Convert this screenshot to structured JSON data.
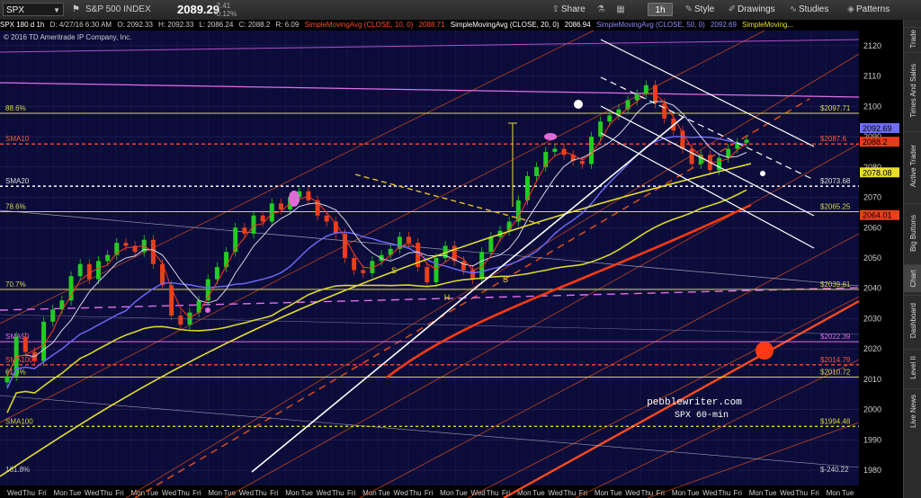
{
  "toolbar": {
    "symbol": "SPX",
    "index_name": "S&P 500 INDEX",
    "last_price": "2089.29",
    "change": "-2.41",
    "change_pct": "-0.12%",
    "share_label": "Share",
    "timeframe": "1h",
    "style_label": "Style",
    "drawings_label": "Drawings",
    "studies_label": "Studies",
    "patterns_label": "Patterns"
  },
  "infobar": {
    "title": "SPX 180 d 1h",
    "date": "D: 4/27/16 6:30 AM",
    "open": "O: 2092.33",
    "high": "H: 2092.33",
    "low": "L: 2086.24",
    "close": "C: 2088.2",
    "range": "R: 6.09",
    "sma10_label": "SimpleMovingAvg (CLOSE, 10, 0)",
    "sma10_value": "2088.71",
    "sma20_label": "SimpleMovingAvg (CLOSE, 20, 0)",
    "sma20_value": "2086.94",
    "sma50_label": "SimpleMovingAvg (CLOSE, 50, 0)",
    "sma50_value": "2092.69",
    "sma100_label": "SimpleMoving..."
  },
  "copyright": "© 2016 TD Ameritrade IP Company, Inc.",
  "sidebar_tabs": [
    "Trade",
    "Times And Sales",
    "Active Trader",
    "Big Buttons",
    "Chart",
    "Dashboard",
    "Level II",
    "Live News"
  ],
  "colors": {
    "background": "#0c0c3a",
    "candle_up": "#22cc22",
    "candle_down": "#e8401a",
    "sma10": "#ff3b1f",
    "sma20": "#d8d8e8",
    "sma50": "#6f6cff",
    "sma100": "#d7d72a",
    "channel": "#e8501a",
    "magenta": "#e070e8",
    "fib": "#d8d850"
  },
  "chart_data": {
    "type": "line",
    "y_axis": {
      "min": 1975,
      "max": 2125,
      "ticks": [
        1980,
        1990,
        2000,
        2010,
        2020,
        2030,
        2040,
        2050,
        2060,
        2070,
        2080,
        2090,
        2100,
        2110,
        2120
      ]
    },
    "x_tick_labels": [
      "Wed",
      "Thu",
      "Fri",
      "Mon",
      "Tue",
      "Wed",
      "Thu",
      "Fri",
      "Mon",
      "Tue",
      "Wed",
      "Thu",
      "Fri",
      "Mon",
      "Tue",
      "Wed",
      "Thu",
      "Fri",
      "Mon",
      "Tue",
      "Wed",
      "Thu",
      "Fri",
      "Mon",
      "Tue",
      "Wed",
      "Thu",
      "Fri",
      "Mon",
      "Tue",
      "Wed",
      "Thu",
      "Fri",
      "Mon",
      "Tue",
      "Wed",
      "Thu",
      "Fri",
      "Mon",
      "Tue",
      "Wed",
      "Thu",
      "Fri",
      "Mon",
      "Tue",
      "Wed",
      "Thu",
      "Fri",
      "Mon",
      "Tue",
      "Wed",
      "Thu",
      "Fri",
      "Mon",
      "Tue"
    ],
    "price_levels": [
      {
        "label": "88.6%",
        "value": 2097.71,
        "price_label": "$2097.71",
        "style": "fib"
      },
      {
        "label": "SMA10",
        "value": 2087.6,
        "price_label": "$2087.6",
        "style": "sma10"
      },
      {
        "label": "SMA20",
        "value": 2073.68,
        "price_label": "$2073.68",
        "style": "sma20"
      },
      {
        "label": "78.6%",
        "value": 2065.25,
        "price_label": "$2065.25",
        "style": "fib"
      },
      {
        "label": "70.7%",
        "value": 2039.61,
        "price_label": "$2039.61",
        "style": "fib"
      },
      {
        "label": "SMA50",
        "value": 2022.39,
        "price_label": "$2022.39",
        "style": "sma50"
      },
      {
        "label": "SMA100",
        "value": 2014.79,
        "price_label": "$2014.79",
        "style": "sma10"
      },
      {
        "label": "61.8%",
        "value": 2010.72,
        "price_label": "$2010.72",
        "style": "fib"
      },
      {
        "label": "SMA100",
        "value": 1994.48,
        "price_label": "$1994.48",
        "style": "sma100"
      },
      {
        "label": "161.8%",
        "value": 1978.5,
        "price_label": "$-240.22",
        "style": "none"
      }
    ],
    "axis_badges": [
      {
        "value": 2092.69,
        "text": "2092.69",
        "color": "#6f6cff"
      },
      {
        "value": 2088.2,
        "text": "2088.2",
        "color": "#e83a1c"
      },
      {
        "value": 2078.08,
        "text": "2078.08",
        "color": "#e8e02a"
      },
      {
        "value": 2064.01,
        "text": "2064.01",
        "color": "#e8401a"
      }
    ],
    "close_series": [
      2011,
      2024,
      2019,
      2016,
      2029,
      2033,
      2036,
      2044,
      2048,
      2043,
      2049,
      2051,
      2055,
      2054,
      2052,
      2056,
      2048,
      2041,
      2031,
      2028,
      2032,
      2036,
      2043,
      2047,
      2052,
      2060,
      2058,
      2064,
      2062,
      2068,
      2066,
      2070,
      2072,
      2069,
      2064,
      2062,
      2058,
      2050,
      2046,
      2045,
      2049,
      2051,
      2053,
      2057,
      2055,
      2047,
      2042,
      2050,
      2054,
      2049,
      2046,
      2043,
      2052,
      2057,
      2059,
      2062,
      2069,
      2077,
      2080,
      2085,
      2086,
      2084,
      2082,
      2081,
      2090,
      2095,
      2097,
      2099,
      2102,
      2104,
      2107,
      2101,
      2096,
      2092,
      2086,
      2081,
      2084,
      2079,
      2083,
      2086,
      2088,
      2089
    ],
    "annotations": [
      {
        "text": "pebblewriter.com"
      },
      {
        "text": "SPX 60-min"
      },
      {
        "text": "S"
      },
      {
        "text": "H"
      },
      {
        "text": "S"
      }
    ]
  }
}
